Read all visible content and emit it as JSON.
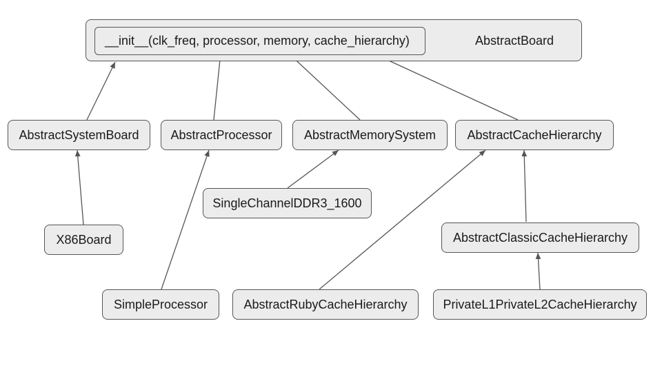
{
  "nodes": {
    "abstract_board": "AbstractBoard",
    "init_method": "__init__(clk_freq, processor, memory, cache_hierarchy)",
    "abstract_system_board": "AbstractSystemBoard",
    "abstract_processor": "AbstractProcessor",
    "abstract_memory_system": "AbstractMemorySystem",
    "abstract_cache_hierarchy": "AbstractCacheHierarchy",
    "x86_board": "X86Board",
    "simple_processor": "SimpleProcessor",
    "single_channel_ddr3": "SingleChannelDDR3_1600",
    "abstract_classic_cache": "AbstractClassicCacheHierarchy",
    "abstract_ruby_cache": "AbstractRubyCacheHierarchy",
    "private_l1_l2_cache": "PrivateL1PrivateL2CacheHierarchy"
  }
}
